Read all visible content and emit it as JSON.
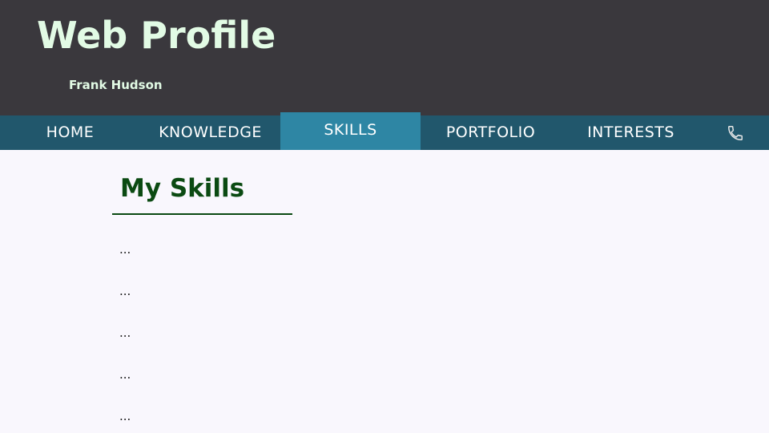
{
  "header": {
    "title": "Web Profile",
    "owner": "Frank Hudson"
  },
  "nav": {
    "items": [
      {
        "label": "HOME"
      },
      {
        "label": "KNOWLEDGE"
      },
      {
        "label": "SKILLS"
      },
      {
        "label": "PORTFOLIO"
      },
      {
        "label": "INTERESTS"
      }
    ],
    "active": "SKILLS",
    "contact_icon": "phone-icon"
  },
  "main": {
    "title": "My Skills",
    "items": [
      "...",
      "...",
      "...",
      "...",
      "..."
    ]
  },
  "colors": {
    "header_bg": "#3a383d",
    "header_text": "#e2fbe5",
    "nav_bg": "#21576c",
    "nav_active_bg": "#2e86a4",
    "page_bg": "#f9f7fd",
    "heading": "#0b4a12"
  }
}
